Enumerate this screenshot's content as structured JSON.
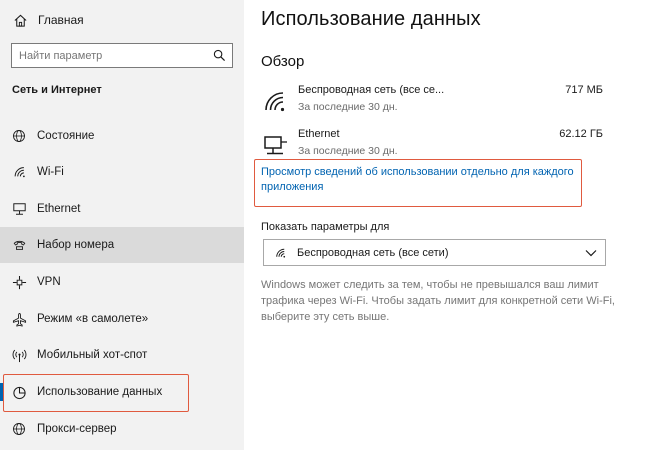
{
  "sidebar": {
    "home_label": "Главная",
    "search_placeholder": "Найти параметр",
    "section_title": "Сеть и Интернет",
    "items": [
      {
        "label": "Состояние",
        "icon": "globe-icon"
      },
      {
        "label": "Wi-Fi",
        "icon": "wifi-icon"
      },
      {
        "label": "Ethernet",
        "icon": "ethernet-icon"
      },
      {
        "label": "Набор номера",
        "icon": "phone-icon"
      },
      {
        "label": "VPN",
        "icon": "vpn-icon"
      },
      {
        "label": "Режим «в самолете»",
        "icon": "airplane-icon"
      },
      {
        "label": "Мобильный хот-спот",
        "icon": "hotspot-icon"
      },
      {
        "label": "Использование данных",
        "icon": "pie-chart-icon"
      },
      {
        "label": "Прокси-сервер",
        "icon": "globe-icon"
      }
    ],
    "hovered_item": "Набор номера",
    "selected_item": "Использование данных"
  },
  "main": {
    "title": "Использование данных",
    "overview_heading": "Обзор",
    "networks": [
      {
        "name": "Беспроводная сеть (все се...",
        "period": "За последние 30 дн.",
        "usage": "717 МБ",
        "icon": "wifi-icon"
      },
      {
        "name": "Ethernet",
        "period": "За последние 30 дн.",
        "usage": "62.12 ГБ",
        "icon": "ethernet-icon"
      }
    ],
    "details_link": "Просмотр сведений об использовании отдельно для каждого приложения",
    "show_settings_label": "Показать параметры для",
    "dropdown_value": "Беспроводная сеть (все сети)",
    "info_text": "Windows может следить за тем, чтобы не превышался ваш лимит трафика через Wi-Fi. Чтобы задать лимит для конкретной сети Wi-Fi, выберите эту сеть выше."
  },
  "colors": {
    "accent": "#0063b1",
    "annotation": "#e05a3f",
    "sidebar_bg": "#f2f2f2",
    "hover_bg": "#dadada"
  }
}
